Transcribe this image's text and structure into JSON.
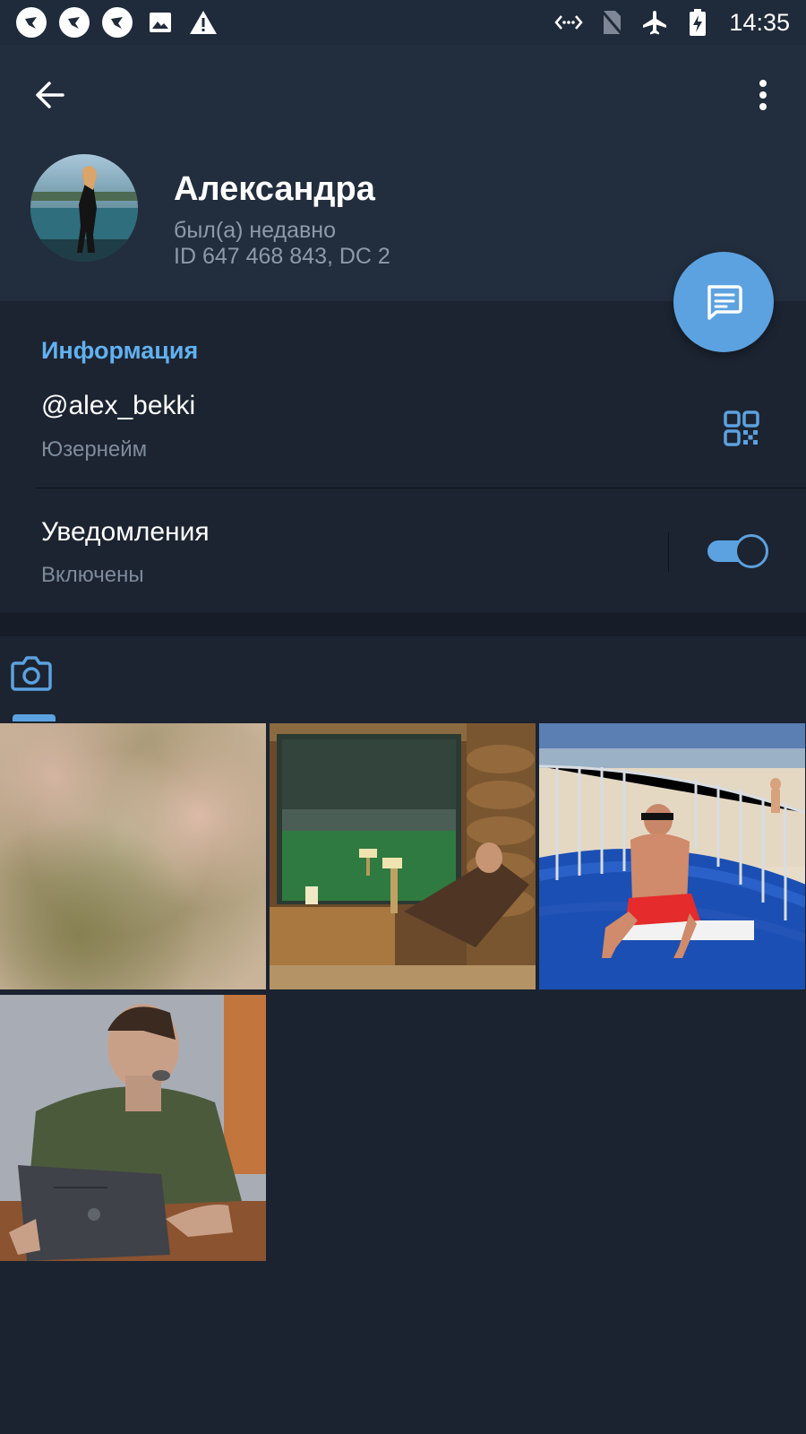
{
  "status_bar": {
    "time": "14:35",
    "left_icons": [
      "app-notification-icon",
      "app-notification-icon",
      "app-notification-icon",
      "image-icon",
      "warning-icon"
    ],
    "right_icons": [
      "data-saver-icon",
      "no-sim-icon",
      "airplane-icon",
      "battery-charging-icon"
    ]
  },
  "header": {
    "back_icon": "arrow-left-icon",
    "menu_icon": "more-vert-icon",
    "name": "Александра",
    "status": "был(а) недавно",
    "id_line": "ID 647 468 843, DC 2"
  },
  "fab": {
    "icon": "message-icon"
  },
  "info": {
    "title": "Информация",
    "username": "@alex_bekki",
    "username_caption": "Юзернейм",
    "qr_icon": "qr-code-icon",
    "notifications_label": "Уведомления",
    "notifications_caption": "Включены",
    "notifications_enabled": true
  },
  "media": {
    "tabs": [
      {
        "icon": "camera-icon",
        "active": true
      }
    ],
    "photos": [
      {
        "description": "blurred"
      },
      {
        "description": "sauna"
      },
      {
        "description": "pool"
      },
      {
        "description": "laptop"
      }
    ]
  },
  "colors": {
    "accent": "#5ca2e0",
    "section_title": "#62b1ef",
    "background": "#1b2330",
    "header_bg": "#222d3d",
    "secondary_text": "#7e8b9c"
  }
}
